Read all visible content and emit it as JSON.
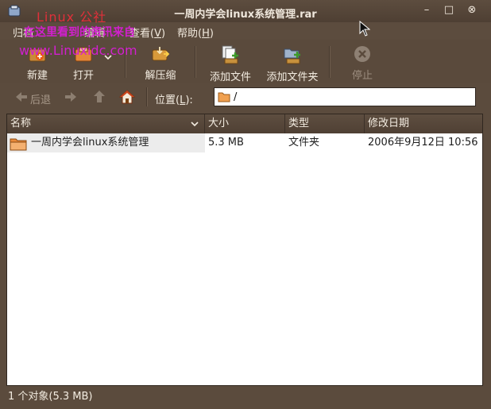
{
  "window": {
    "title": "一周内学会linux系统管理.rar"
  },
  "watermark": {
    "line1": "Linux 公社",
    "line2": "在这里看到的资讯来自",
    "line3": "www.Linuxidc.com"
  },
  "menu": {
    "archive": "归档",
    "edit": "编辑",
    "view_prefix": "查看(",
    "view_key": "V",
    "view_suffix": ")",
    "help_prefix": "帮助(",
    "help_key": "H",
    "help_suffix": ")"
  },
  "toolbar": {
    "new": "新建",
    "open": "打开",
    "extract": "解压缩",
    "add_files": "添加文件",
    "add_folder": "添加文件夹",
    "stop": "停止"
  },
  "location": {
    "back": "后退",
    "label_prefix": "位置(",
    "label_key": "L",
    "label_suffix": "):",
    "path": "/"
  },
  "columns": {
    "name": "名称",
    "size": "大小",
    "type": "类型",
    "modified": "修改日期"
  },
  "rows": [
    {
      "name": "一周内学会linux系统管理",
      "size": "5.3 MB",
      "type": "文件夹",
      "modified": "2006年9月12日 10:56"
    }
  ],
  "status": "1 个对象(5.3 MB)",
  "colors": {
    "window_bg": "#5a4a3c",
    "watermark_red": "#e0303a",
    "watermark_magenta": "#d21fcf",
    "folder_orange": "#f0a050"
  }
}
